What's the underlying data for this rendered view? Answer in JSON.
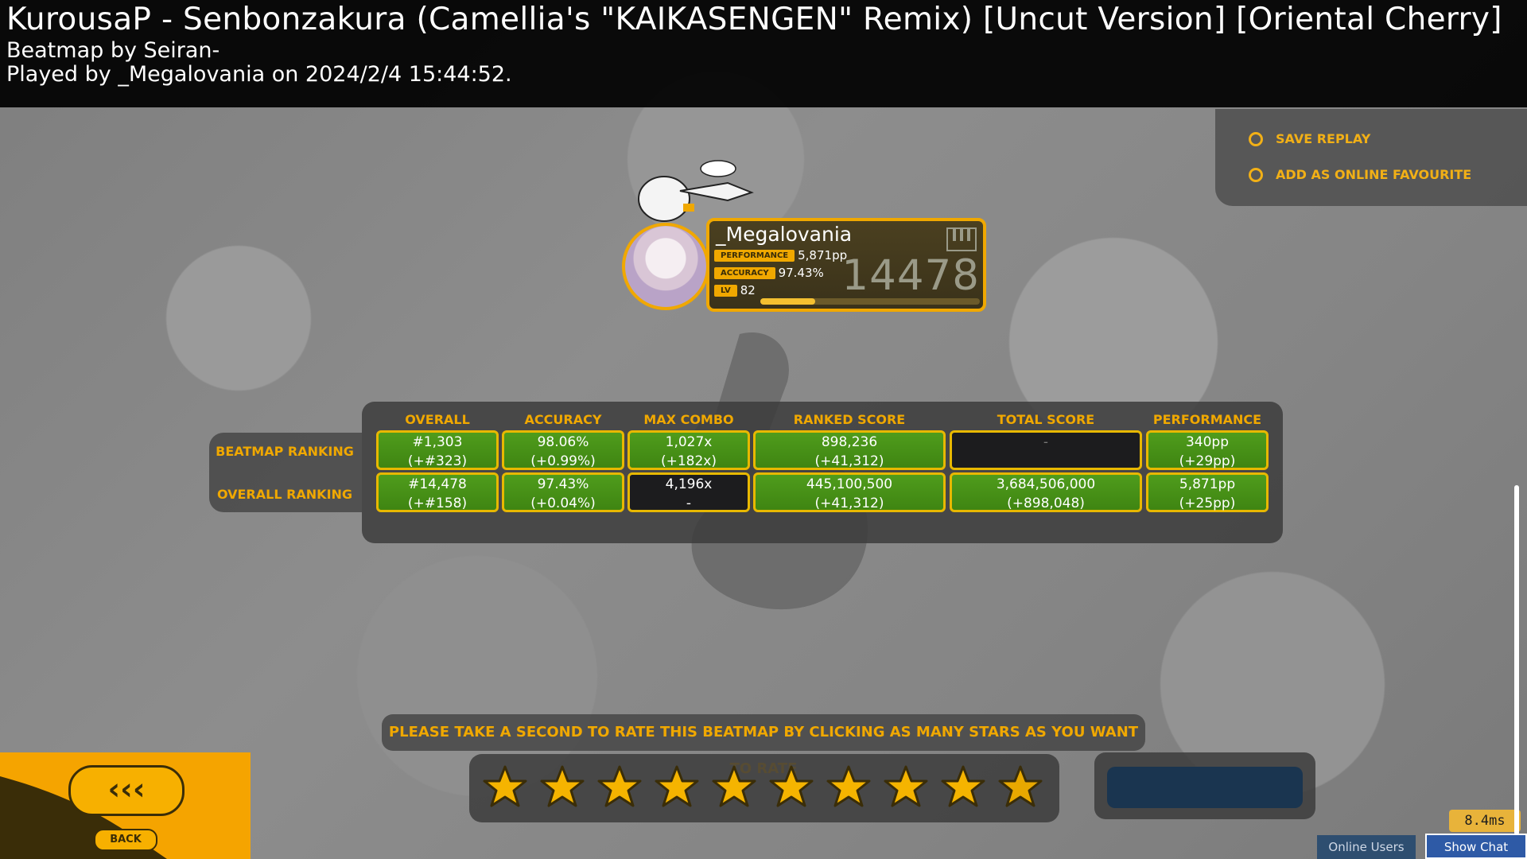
{
  "header": {
    "song_title": "KurousaP - Senbonzakura (Camellia's \"KAIKASENGEN\" Remix) [Uncut Version] [Oriental Cherry]",
    "mapper": "Beatmap by Seiran-",
    "played_by": "Played by _Megalovania on 2024/2/4 15:44:52."
  },
  "options": {
    "save_replay": "SAVE REPLAY",
    "add_favourite": "ADD AS ONLINE FAVOURITE"
  },
  "user": {
    "name": "_Megalovania",
    "rank": "14478",
    "performance_label": "PERFORMANCE",
    "performance_value": "5,871pp",
    "accuracy_label": "ACCURACY",
    "accuracy_value": "97.43%",
    "level_label": "LV",
    "level_value": "82",
    "level_progress": 0.25
  },
  "ranking": {
    "columns": [
      "OVERALL",
      "ACCURACY",
      "MAX COMBO",
      "RANKED SCORE",
      "TOTAL SCORE",
      "PERFORMANCE"
    ],
    "row_labels": [
      "BEATMAP RANKING",
      "OVERALL RANKING"
    ],
    "beatmap": [
      {
        "l1": "#1,303",
        "l2": "(+#323)"
      },
      {
        "l1": "98.06%",
        "l2": "(+0.99%)"
      },
      {
        "l1": "1,027x",
        "l2": "(+182x)"
      },
      {
        "l1": "898,236",
        "l2": "(+41,312)"
      },
      {
        "l1": "-",
        "l2": ""
      },
      {
        "l1": "340pp",
        "l2": "(+29pp)"
      }
    ],
    "overall": [
      {
        "l1": "#14,478",
        "l2": "(+#158)"
      },
      {
        "l1": "97.43%",
        "l2": "(+0.04%)"
      },
      {
        "l1": "4,196x",
        "l2": "-"
      },
      {
        "l1": "445,100,500",
        "l2": "(+41,312)"
      },
      {
        "l1": "3,684,506,000",
        "l2": "(+898,048)"
      },
      {
        "l1": "5,871pp",
        "l2": "(+25pp)"
      }
    ]
  },
  "rating": {
    "prompt": "PLEASE TAKE A SECOND TO RATE THIS BEATMAP BY CLICKING AS MANY STARS AS YOU WANT TO RATE",
    "star_count": 10,
    "star_color": "#f5b400"
  },
  "back": {
    "arrows": "‹‹‹",
    "label": "BACK"
  },
  "status": {
    "frame_time": "8.4ms",
    "online_users": "Online Users",
    "show_chat": "Show Chat"
  },
  "colors": {
    "accent": "#f0a800",
    "cell_green": "#4f9c1c",
    "cell_dark": "#1c1c1e"
  }
}
